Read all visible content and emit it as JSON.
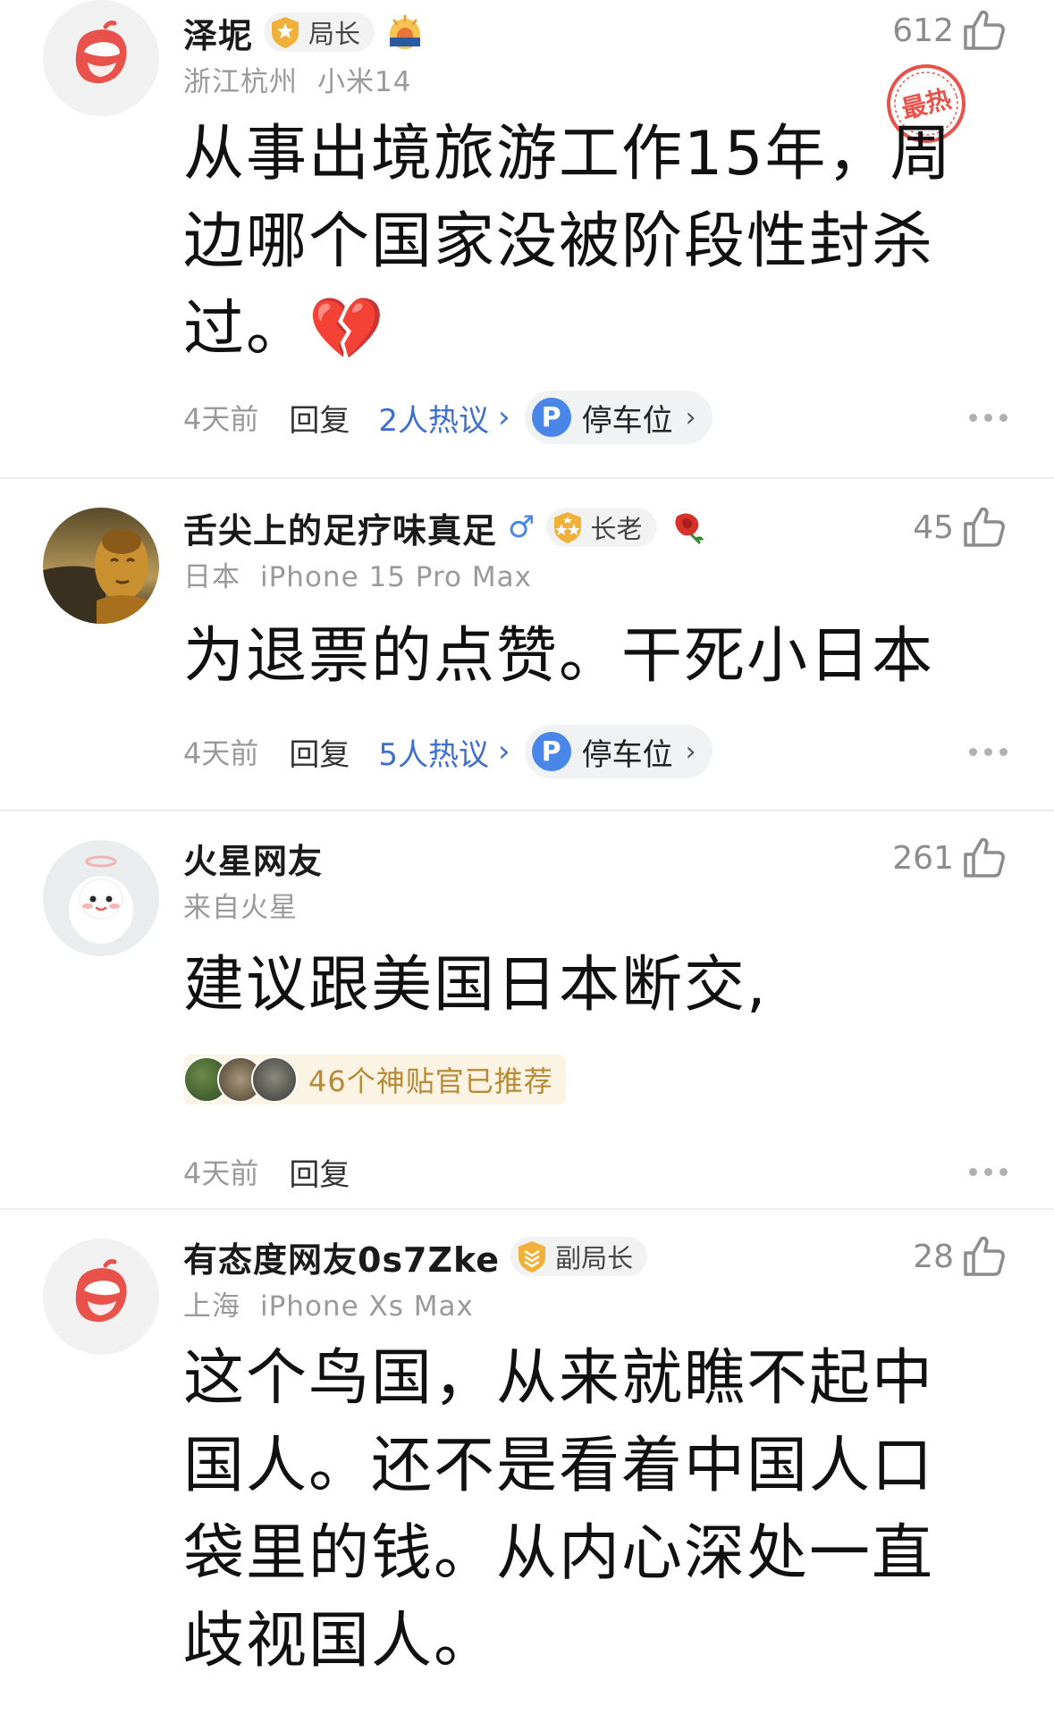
{
  "comments": [
    {
      "username": "泽坭",
      "rank": "局长",
      "location": "浙江杭州",
      "device": "小米14",
      "likes": "612",
      "hot_stamp": "最热",
      "body": "从事出境旅游工作15年，周边哪个国家没被阶段性封杀过。💔",
      "time": "4天前",
      "reply": "回复",
      "hot_discussion": "2人热议",
      "parking": "停车位"
    },
    {
      "username": "舌尖上的足疗味真足",
      "gender_icon": "♂",
      "rank": "长老",
      "location": "日本",
      "device": "iPhone 15 Pro Max",
      "likes": "45",
      "body": "为退票的点赞。干死小日本",
      "time": "4天前",
      "reply": "回复",
      "hot_discussion": "5人热议",
      "parking": "停车位"
    },
    {
      "username": "火星网友",
      "location": "来自火星",
      "likes": "261",
      "body": "建议跟美国日本断交,",
      "recommend": "46个神贴官已推荐",
      "time": "4天前",
      "reply": "回复"
    },
    {
      "username": "有态度网友0s7Zke",
      "rank": "副局长",
      "location": "上海",
      "device": "iPhone Xs Max",
      "likes": "28",
      "body": "这个鸟国，从来就瞧不起中国人。还不是看着中国人口袋里的钱。从内心深处一直歧视国人。"
    }
  ],
  "colors": {
    "link_blue": "#3e6fd0",
    "brand_red": "#e8524a",
    "badge_gold": "#f0b13a",
    "recommend_text": "#b98a35"
  }
}
